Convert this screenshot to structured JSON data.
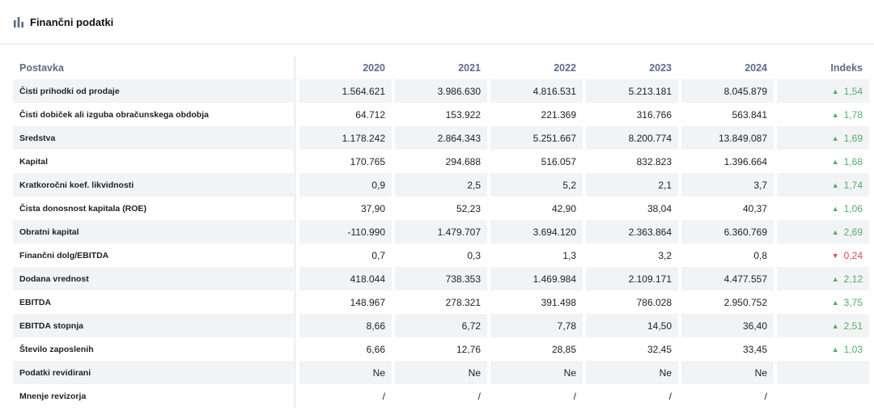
{
  "header": {
    "title": "Finančni podatki",
    "icon": "bar-chart-icon"
  },
  "colors": {
    "up": "#4caf6a",
    "down": "#e04545",
    "header_text": "#5b6d85",
    "row_shade": "#f2f3f5"
  },
  "table": {
    "label_header": "Postavka",
    "years": [
      "2020",
      "2021",
      "2022",
      "2023",
      "2024"
    ],
    "index_header": "Indeks",
    "rows": [
      {
        "label": "Čisti prihodki od prodaje",
        "values": [
          "1.564.621",
          "3.986.630",
          "4.816.531",
          "5.213.181",
          "8.045.879"
        ],
        "index": "1,54",
        "trend": "up"
      },
      {
        "label": "Čisti dobiček ali izguba obračunskega obdobja",
        "values": [
          "64.712",
          "153.922",
          "221.369",
          "316.766",
          "563.841"
        ],
        "index": "1,78",
        "trend": "up"
      },
      {
        "label": "Sredstva",
        "values": [
          "1.178.242",
          "2.864.343",
          "5.251.667",
          "8.200.774",
          "13.849.087"
        ],
        "index": "1,69",
        "trend": "up"
      },
      {
        "label": "Kapital",
        "values": [
          "170.765",
          "294.688",
          "516.057",
          "832.823",
          "1.396.664"
        ],
        "index": "1,68",
        "trend": "up"
      },
      {
        "label": "Kratkoročni koef. likvidnosti",
        "values": [
          "0,9",
          "2,5",
          "5,2",
          "2,1",
          "3,7"
        ],
        "index": "1,74",
        "trend": "up"
      },
      {
        "label": "Čista donosnost kapitala (ROE)",
        "values": [
          "37,90",
          "52,23",
          "42,90",
          "38,04",
          "40,37"
        ],
        "index": "1,06",
        "trend": "up"
      },
      {
        "label": "Obratni kapital",
        "values": [
          "-110.990",
          "1.479.707",
          "3.694.120",
          "2.363.864",
          "6.360.769"
        ],
        "index": "2,69",
        "trend": "up"
      },
      {
        "label": "Finančni dolg/EBITDA",
        "values": [
          "0,7",
          "0,3",
          "1,3",
          "3,2",
          "0,8"
        ],
        "index": "0,24",
        "trend": "down"
      },
      {
        "label": "Dodana vrednost",
        "values": [
          "418.044",
          "738.353",
          "1.469.984",
          "2.109.171",
          "4.477.557"
        ],
        "index": "2,12",
        "trend": "up"
      },
      {
        "label": "EBITDA",
        "values": [
          "148.967",
          "278.321",
          "391.498",
          "786.028",
          "2.950.752"
        ],
        "index": "3,75",
        "trend": "up"
      },
      {
        "label": "EBITDA stopnja",
        "values": [
          "8,66",
          "6,72",
          "7,78",
          "14,50",
          "36,40"
        ],
        "index": "2,51",
        "trend": "up"
      },
      {
        "label": "Število zaposlenih",
        "values": [
          "6,66",
          "12,76",
          "28,85",
          "32,45",
          "33,45"
        ],
        "index": "1,03",
        "trend": "up"
      },
      {
        "label": "Podatki revidirani",
        "values": [
          "Ne",
          "Ne",
          "Ne",
          "Ne",
          "Ne"
        ],
        "index": "",
        "trend": ""
      },
      {
        "label": "Mnenje revizorja",
        "values": [
          "/",
          "/",
          "/",
          "/",
          "/"
        ],
        "index": "",
        "trend": ""
      }
    ]
  }
}
